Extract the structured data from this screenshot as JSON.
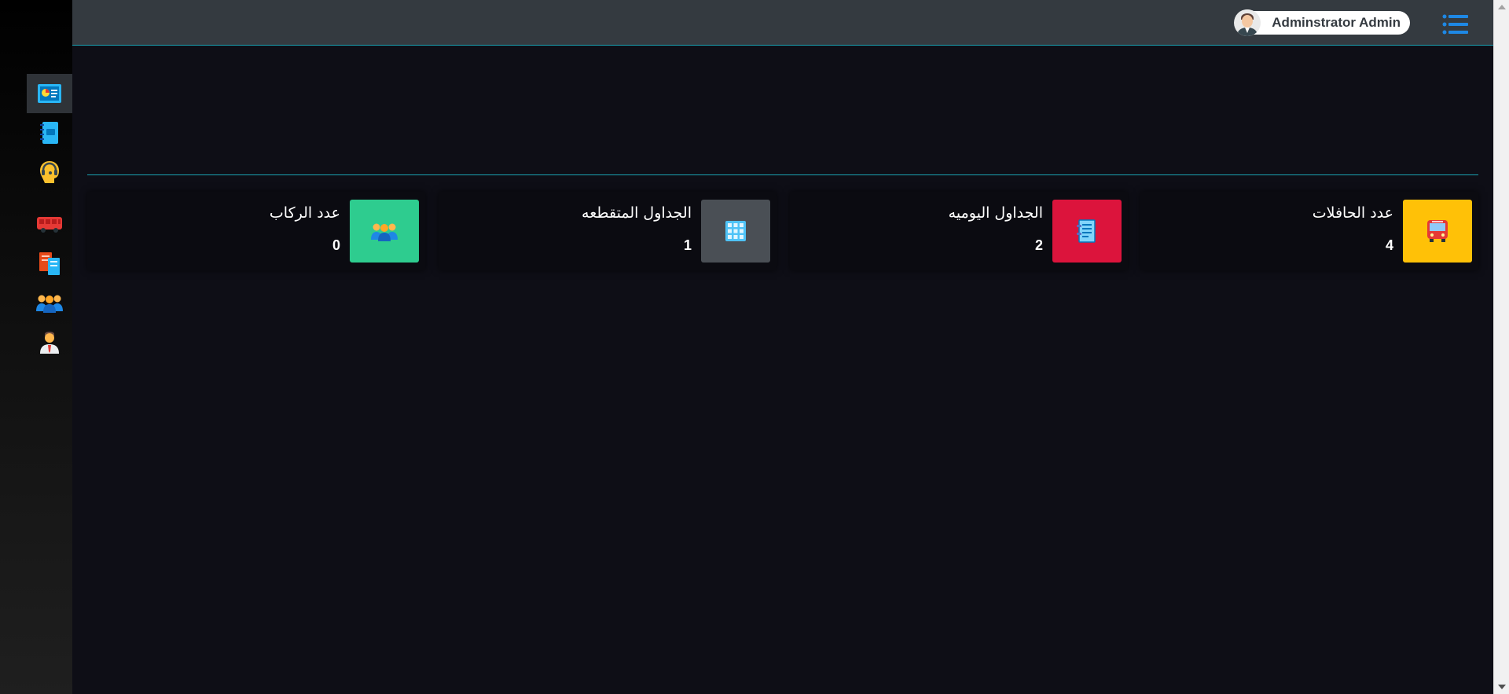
{
  "header": {
    "user_name": "Adminstrator Admin"
  },
  "sidebar": {
    "items": [
      {
        "icon": "dashboard-card-icon",
        "active": true
      },
      {
        "icon": "notebook-icon",
        "active": false
      },
      {
        "icon": "support-headset-icon",
        "active": false
      },
      {
        "icon": "bus-icon",
        "active": false
      },
      {
        "icon": "documents-icon",
        "active": false
      },
      {
        "icon": "group-icon",
        "active": false
      },
      {
        "icon": "employee-icon",
        "active": false
      }
    ]
  },
  "cards": [
    {
      "title": "عدد الحافلات",
      "value": "4",
      "icon": "bus-icon",
      "color": "#ffc107"
    },
    {
      "title": "الجداول اليوميه",
      "value": "2",
      "icon": "schedule-sheet-icon",
      "color": "#dc143c"
    },
    {
      "title": "الجداول المتقطعه",
      "value": "1",
      "icon": "grid-icon",
      "color": "#4a4f55"
    },
    {
      "title": "عدد الركاب",
      "value": "0",
      "icon": "passengers-icon",
      "color": "#2ecc8f"
    }
  ],
  "colors": {
    "header_bg": "#343a40",
    "accent_line": "#1aa3b3",
    "page_bg": "#0e0e16"
  }
}
